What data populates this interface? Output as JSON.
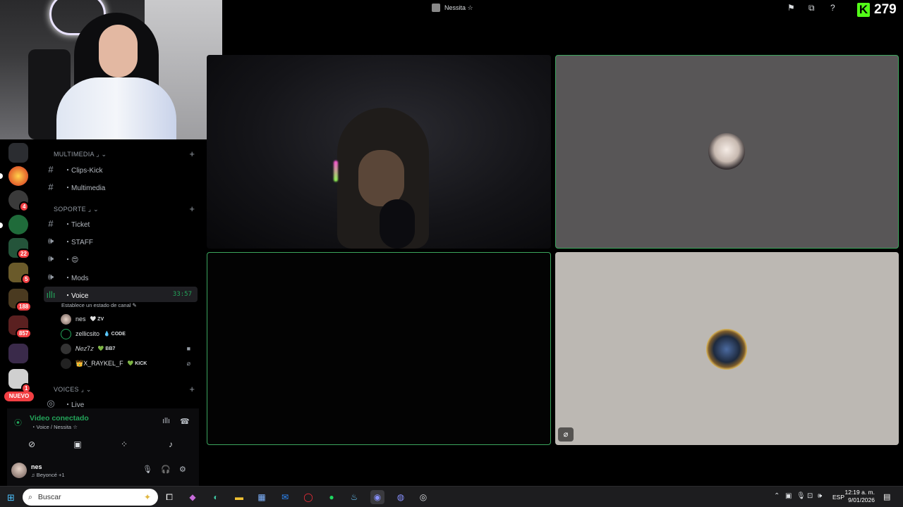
{
  "stream": {
    "title": "Nessita ☆",
    "kick_count": "279",
    "kick_logo": "K"
  },
  "categories": {
    "multimedia": "MULTIMEDIA ⌟ ⌄",
    "soporte": "SOPORTE ⌟ ⌄",
    "voices": "VOICES ⌟ ⌄",
    "add": "+"
  },
  "channels": {
    "clips_kick": "・Clips-Kick",
    "multimedia": "・Multimedia",
    "ticket": "・Ticket",
    "staff": "・STAFF",
    "emoji_channel": "・😍",
    "mods": "・Mods",
    "voice": "・Voice",
    "voice_timer": "33:57",
    "voice_status": "Establece un estado de canal ✎",
    "live": "・Live"
  },
  "members": [
    {
      "name": "nes",
      "tag": "🤍 ZV"
    },
    {
      "name": "zellicsito",
      "tag": "💧 CODE"
    },
    {
      "name": "𝑁𝑒𝑧7𝑧",
      "tag": "💚 BB7"
    },
    {
      "name": "👑X_RAYKEL_F",
      "tag": "💚 KICK"
    }
  ],
  "voice_panel": {
    "title": "Video conectado",
    "subtitle": "・Voice / Nessita ☆"
  },
  "user": {
    "name": "nes",
    "activity": "♫ Beyoncé +1"
  },
  "rail": {
    "badges": [
      "4",
      "22",
      "5",
      "188",
      "857",
      "1"
    ],
    "nuevo": "NUEVO"
  },
  "taskbar": {
    "search_placeholder": "Buscar",
    "lang": "ESP",
    "time": "12:19 a. m.",
    "date": "9/01/2026"
  },
  "colors": {
    "accent_green": "#23a55a",
    "kick_green": "#53fc18",
    "badge_red": "#f23f43"
  }
}
